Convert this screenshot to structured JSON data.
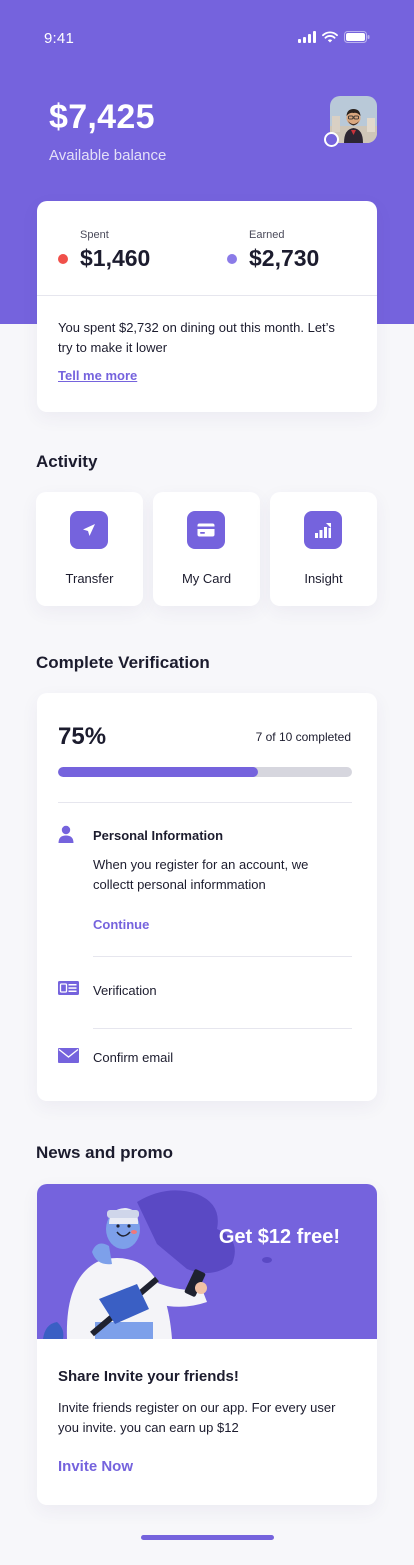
{
  "status_bar": {
    "time": "9:41"
  },
  "header": {
    "balance": "$7,425",
    "balance_label": "Available balance"
  },
  "summary": {
    "spent_label": "Spent",
    "spent_value": "$1,460",
    "earned_label": "Earned",
    "earned_value": "$2,730",
    "message": "You spent $2,732 on dining out this month. Let’s try to make it lower",
    "link": "Tell me more",
    "spent_color": "#f0504a",
    "earned_color": "#8b7be8"
  },
  "activity": {
    "title": "Activity",
    "items": [
      {
        "label": "Transfer",
        "icon": "send-icon"
      },
      {
        "label": "My Card",
        "icon": "card-icon"
      },
      {
        "label": "Insight",
        "icon": "chart-icon"
      }
    ]
  },
  "verification": {
    "title": "Complete Verification",
    "percent": "75%",
    "progress": 0.68,
    "completed": "7 of 10 completed",
    "steps": [
      {
        "title": "Personal Information",
        "description": "When you register for an account, we collectt personal informmation",
        "action": "Continue",
        "icon": "person-icon"
      },
      {
        "title": "Verification",
        "icon": "id-card-icon"
      },
      {
        "title": "Confirm email",
        "icon": "mail-icon"
      }
    ]
  },
  "news": {
    "title": "News and promo",
    "headline": "Get $12 free!",
    "card_title": "Share Invite your friends!",
    "card_text": "Invite friends register on our app. For every user you invite. you can earn up $12",
    "cta": "Invite Now"
  },
  "colors": {
    "accent": "#7563dd",
    "background": "#f7f7fa",
    "text": "#1c1c2e"
  }
}
